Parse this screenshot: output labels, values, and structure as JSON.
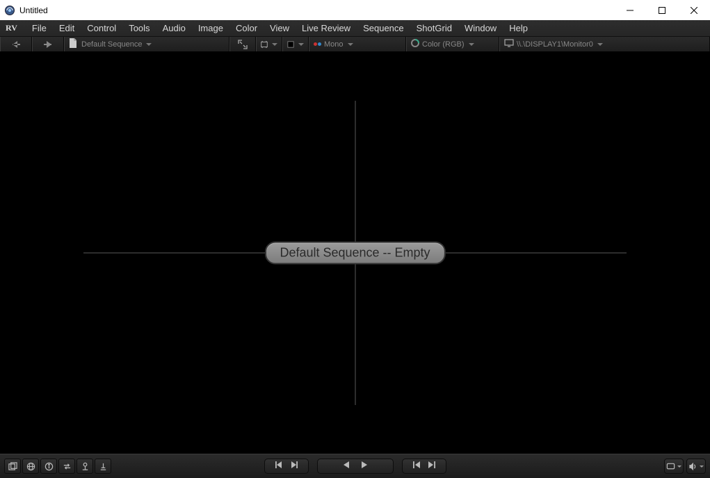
{
  "window": {
    "title": "Untitled",
    "brand": "RV"
  },
  "menus": {
    "file": "File",
    "edit": "Edit",
    "control": "Control",
    "tools": "Tools",
    "audio": "Audio",
    "image": "Image",
    "color": "Color",
    "view": "View",
    "livereview": "Live Review",
    "sequence": "Sequence",
    "shotgrid": "ShotGrid",
    "window": "Window",
    "help": "Help"
  },
  "toolbar": {
    "sequence_label": "Default Sequence",
    "stereo_label": "Mono",
    "color_label": "Color (RGB)",
    "display_label": "\\\\.\\DISPLAY1\\Monitor0"
  },
  "viewport": {
    "badge_text": "Default Sequence -- Empty"
  }
}
